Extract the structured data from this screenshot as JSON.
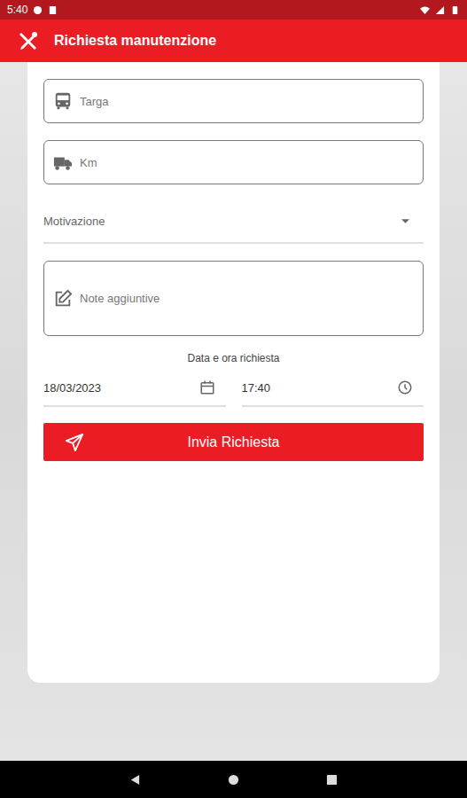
{
  "status_bar": {
    "time": "5:40"
  },
  "app_bar": {
    "title": "Richiesta manutenzione"
  },
  "form": {
    "plate": {
      "placeholder": "Targa"
    },
    "km": {
      "placeholder": "Km"
    },
    "reason": {
      "label": "Motivazione"
    },
    "notes": {
      "placeholder": "Note aggiuntive"
    },
    "datetime_label": "Data e ora richiesta",
    "date": "18/03/2023",
    "time": "17:40"
  },
  "buttons": [
    "Invia Richiesta"
  ]
}
